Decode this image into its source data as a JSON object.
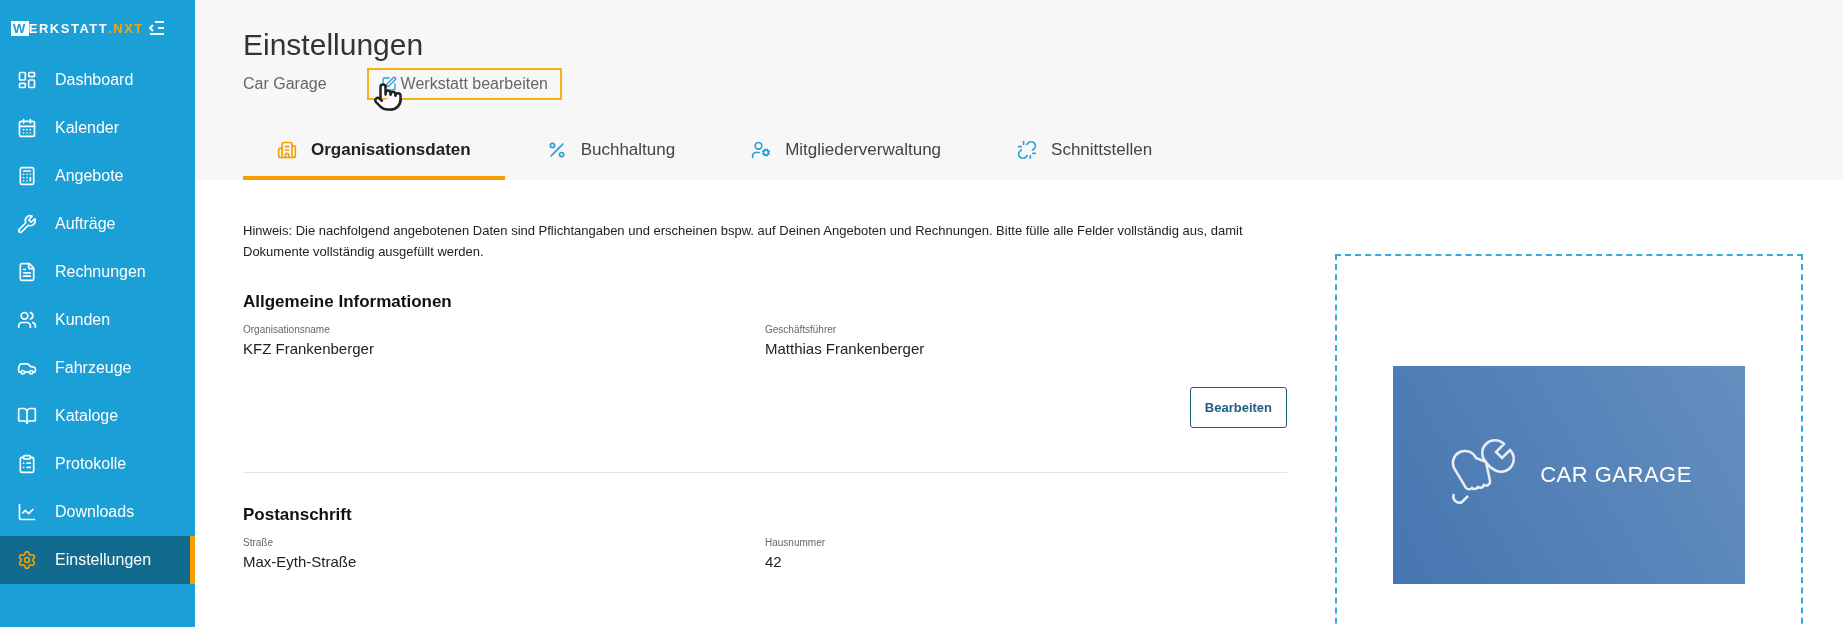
{
  "sidebar": {
    "logo": {
      "first_letter": "W",
      "rest": "ERKSTATT",
      "suffix": ".NXT"
    },
    "items": [
      {
        "label": "Dashboard",
        "selected": false
      },
      {
        "label": "Kalender",
        "selected": false
      },
      {
        "label": "Angebote",
        "selected": false
      },
      {
        "label": "Aufträge",
        "selected": false
      },
      {
        "label": "Rechnungen",
        "selected": false
      },
      {
        "label": "Kunden",
        "selected": false
      },
      {
        "label": "Fahrzeuge",
        "selected": false
      },
      {
        "label": "Kataloge",
        "selected": false
      },
      {
        "label": "Protokolle",
        "selected": false
      },
      {
        "label": "Downloads",
        "selected": false
      },
      {
        "label": "Einstellungen",
        "selected": true
      }
    ]
  },
  "header": {
    "title": "Einstellungen",
    "subtitle": "Car Garage",
    "edit_link": "Werkstatt bearbeiten"
  },
  "tabs": [
    {
      "label": "Organisationsdaten",
      "selected": true
    },
    {
      "label": "Buchhaltung",
      "selected": false
    },
    {
      "label": "Mitgliederverwaltung",
      "selected": false
    },
    {
      "label": "Schnittstellen",
      "selected": false
    }
  ],
  "notice": "Hinweis: Die nachfolgend angebotenen Daten sind Pflichtangaben und erscheinen bspw. auf Deinen Angeboten und Rechnungen. Bitte fülle alle Felder vollständig aus, damit Dokumente vollständig ausgefüllt werden.",
  "sections": [
    {
      "title": "Allgemeine Informationen",
      "fields": [
        {
          "label": "Organisationsname",
          "value": "KFZ Frankenberger"
        },
        {
          "label": "Geschäftsführer",
          "value": "Matthias Frankenberger"
        }
      ],
      "button": "Bearbeiten"
    },
    {
      "title": "Postanschrift",
      "fields": [
        {
          "label": "Straße",
          "value": "Max-Eyth-Straße"
        },
        {
          "label": "Hausnummer",
          "value": "42"
        }
      ]
    }
  ],
  "logo_image": {
    "text": "CAR GARAGE"
  }
}
